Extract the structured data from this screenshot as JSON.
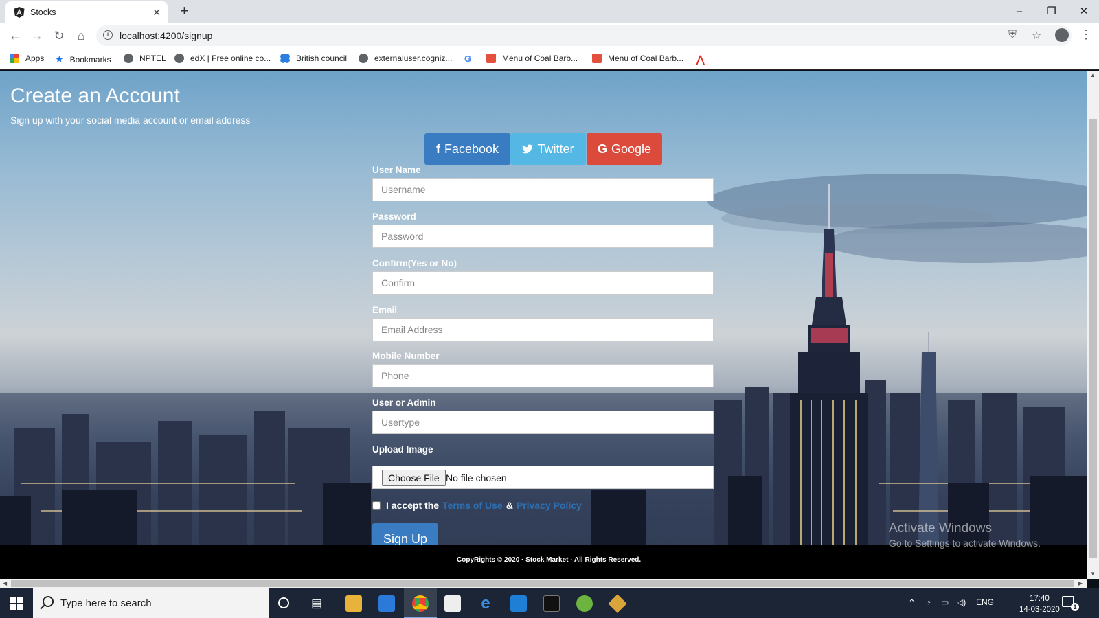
{
  "browser": {
    "tab_title": "Stocks",
    "url": "localhost:4200/signup",
    "bookmarks": [
      "Apps",
      "Bookmarks",
      "NPTEL",
      "edX | Free online co...",
      "British council",
      "externaluser.cogniz...",
      "Menu of Coal Barb...",
      "Menu of Coal Barb..."
    ]
  },
  "page": {
    "title": "Create an Account",
    "subtitle": "Sign up with your social media account or email address"
  },
  "social": {
    "facebook": "Facebook",
    "twitter": "Twitter",
    "google": "Google"
  },
  "form": {
    "username_label": "User Name",
    "username_placeholder": "Username",
    "password_label": "Password",
    "password_placeholder": "Password",
    "confirm_label": "Confirm(Yes or No)",
    "confirm_placeholder": "Confirm",
    "email_label": "Email",
    "email_placeholder": "Email Address",
    "mobile_label": "Mobile Number",
    "mobile_placeholder": "Phone",
    "usertype_label": "User or Admin",
    "usertype_placeholder": "Usertype",
    "upload_label": "Upload Image",
    "choose_file": "Choose File",
    "file_status": "No file chosen",
    "terms_prefix": "I accept the",
    "terms_link": "Terms of Use",
    "terms_and": "&",
    "privacy_link": "Privacy Policy",
    "signup_button": "Sign Up"
  },
  "footer": {
    "text": "CopyRights © 2020 · Stock Market · All Rights Reserved."
  },
  "watermark": {
    "line1": "Activate Windows",
    "line2": "Go to Settings to activate Windows."
  },
  "taskbar": {
    "search_placeholder": "Type here to search",
    "language": "ENG",
    "time": "17:40",
    "date": "14-03-2020",
    "notification_count": "1"
  }
}
